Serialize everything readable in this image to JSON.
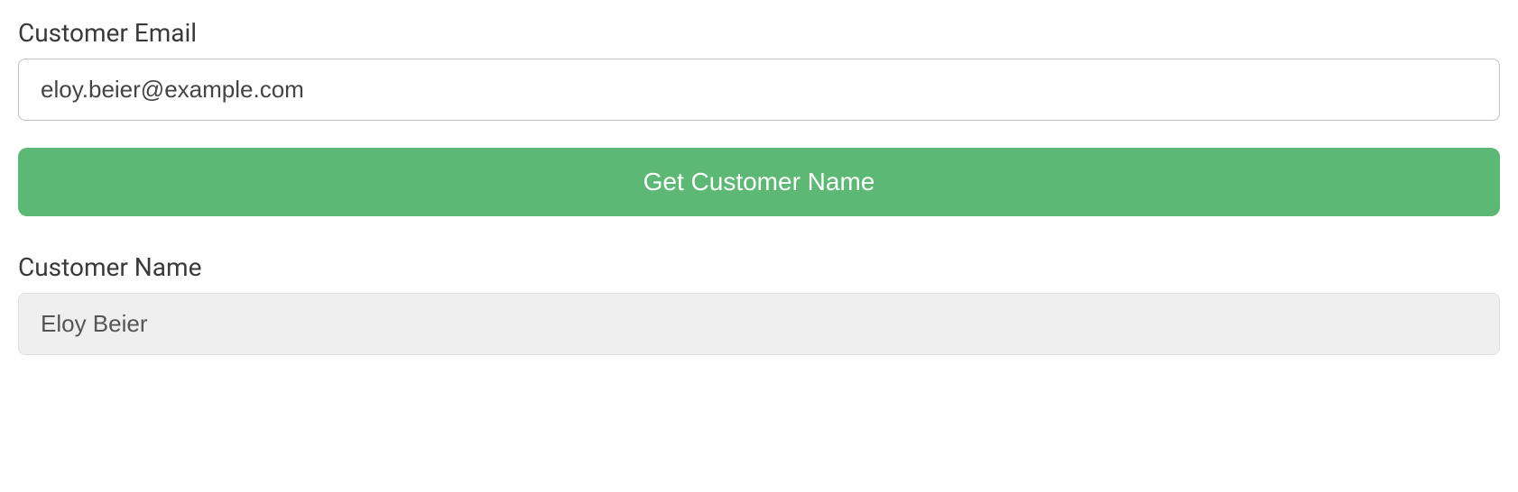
{
  "form": {
    "emailLabel": "Customer Email",
    "emailValue": "eloy.beier@example.com",
    "submitLabel": "Get Customer Name",
    "nameLabel": "Customer Name",
    "nameValue": "Eloy Beier"
  }
}
